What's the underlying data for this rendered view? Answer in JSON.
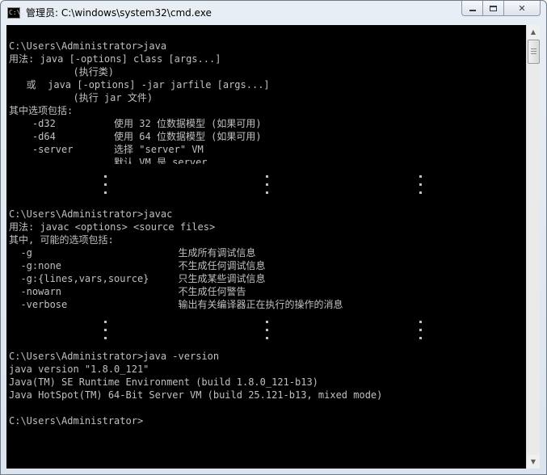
{
  "window": {
    "title": "管理员: C:\\windows\\system32\\cmd.exe",
    "icon_text": "C:\\."
  },
  "console": {
    "section1": [
      "C:\\Users\\Administrator>java",
      "用法: java [-options] class [args...]",
      "           (执行类)",
      "   或  java [-options] -jar jarfile [args...]",
      "           (执行 jar 文件)",
      "其中选项包括:",
      "    -d32          使用 32 位数据模型 (如果可用)",
      "    -d64          使用 64 位数据模型 (如果可用)",
      "    -server       选择 \"server\" VM",
      "                  默认 VM 是 server"
    ],
    "section2": [
      "C:\\Users\\Administrator>javac",
      "用法: javac <options> <source files>",
      "其中, 可能的选项包括:",
      "  -g                         生成所有调试信息",
      "  -g:none                    不生成任何调试信息",
      "  -g:{lines,vars,source}     只生成某些调试信息",
      "  -nowarn                    不生成任何警告",
      "  -verbose                   输出有关编译器正在执行的操作的消息"
    ],
    "section3": [
      "C:\\Users\\Administrator>java -version",
      "java version \"1.8.0_121\"",
      "Java(TM) SE Runtime Environment (build 1.8.0_121-b13)",
      "Java HotSpot(TM) 64-Bit Server VM (build 25.121-b13, mixed mode)",
      "",
      "C:\\Users\\Administrator>"
    ]
  },
  "colors": {
    "console_background": "#000000",
    "console_text": "#c0c0c0"
  },
  "icons": {
    "minimize": "minimize-icon",
    "maximize": "maximize-icon",
    "close": "close-icon"
  }
}
